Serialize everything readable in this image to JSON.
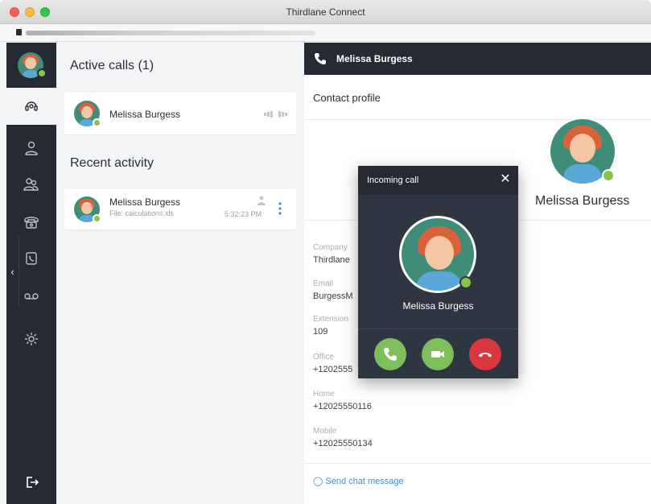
{
  "window": {
    "title": "Thirdlane Connect"
  },
  "sidebar": {
    "items": [
      {
        "name": "active-calls",
        "icon": "headset-icon"
      },
      {
        "name": "contacts",
        "icon": "person-icon"
      },
      {
        "name": "groups",
        "icon": "people-icon"
      },
      {
        "name": "dialpad",
        "icon": "telephone-icon"
      },
      {
        "name": "call-history",
        "icon": "history-icon"
      },
      {
        "name": "voicemail",
        "icon": "voicemail-icon"
      },
      {
        "name": "settings",
        "icon": "gear-icon"
      }
    ],
    "logout_icon": "logout-icon"
  },
  "calls_panel": {
    "active_title": "Active calls (1)",
    "active_call": {
      "name": "Melissa Burgess"
    },
    "recent_title": "Recent activity",
    "recent_item": {
      "name": "Melissa Burgess",
      "file": "File: calculations.xls",
      "time": "5:32:23 PM"
    }
  },
  "right_panel": {
    "header_title": "Melissa Burgess",
    "profile_label": "Contact profile",
    "profile_name": "Melissa Burgess",
    "fields": [
      {
        "label": "Company",
        "value": "Thirdlane"
      },
      {
        "label": "Email",
        "value": "BurgessM"
      },
      {
        "label": "Extension",
        "value": "109"
      },
      {
        "label": "Office",
        "value": "+1202555"
      },
      {
        "label": "Home",
        "value": "+12025550116"
      },
      {
        "label": "Mobile",
        "value": "+12025550134"
      }
    ],
    "chat_link": "Send chat message"
  },
  "incoming_call": {
    "title": "Incoming call",
    "caller": "Melissa Burgess"
  },
  "colors": {
    "sidebar_bg": "#262b33",
    "accent_green": "#7cbf5b",
    "decline_red": "#d9363e",
    "status_online": "#8bc34a",
    "link_blue": "#3e8fcf"
  }
}
